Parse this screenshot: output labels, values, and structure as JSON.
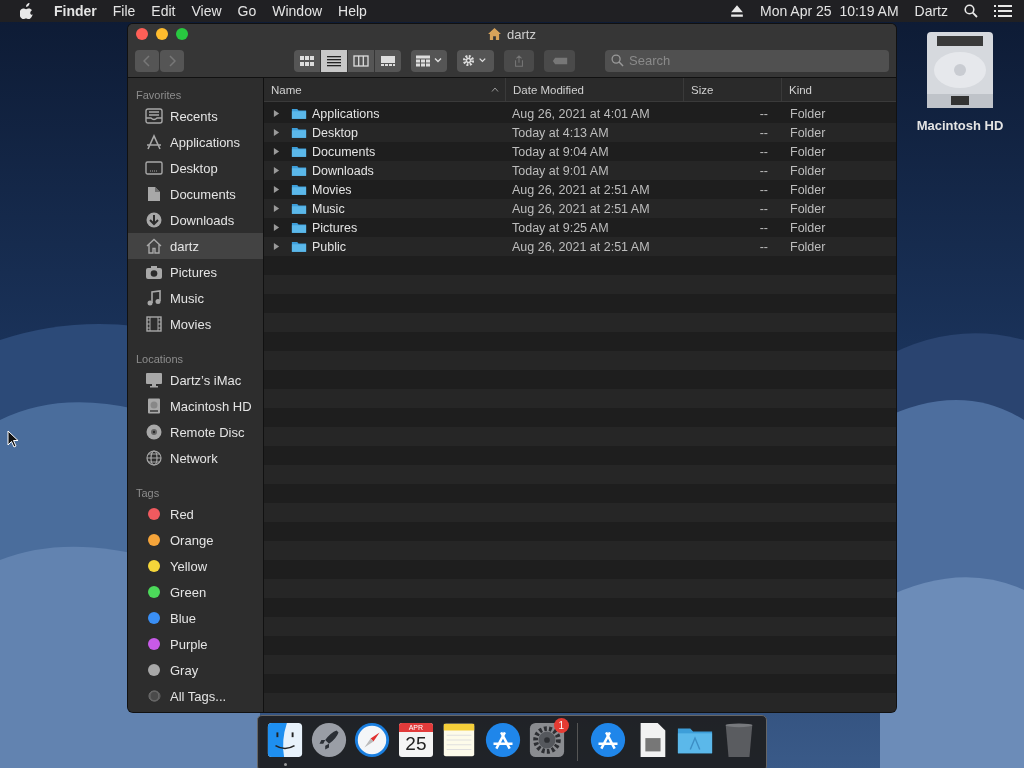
{
  "menu_bar": {
    "app": "Finder",
    "items": [
      "File",
      "Edit",
      "View",
      "Go",
      "Window",
      "Help"
    ],
    "clock": "Mon Apr 25  10:19 AM",
    "user": "Dartz"
  },
  "window": {
    "title": "dartz"
  },
  "toolbar": {
    "views": [
      {
        "kind": "icons",
        "selected": false
      },
      {
        "kind": "list",
        "selected": true
      },
      {
        "kind": "columns",
        "selected": false
      },
      {
        "kind": "gallery",
        "selected": false
      }
    ],
    "search": {
      "placeholder": "Search"
    }
  },
  "sidebar": {
    "sections": [
      {
        "title": "Favorites",
        "items": [
          {
            "label": "Recents",
            "kind": "recents",
            "selected": false
          },
          {
            "label": "Applications",
            "kind": "applications",
            "selected": false
          },
          {
            "label": "Desktop",
            "kind": "desktop",
            "selected": false
          },
          {
            "label": "Documents",
            "kind": "documents",
            "selected": false
          },
          {
            "label": "Downloads",
            "kind": "downloads",
            "selected": false
          },
          {
            "label": "dartz",
            "kind": "home",
            "selected": true
          },
          {
            "label": "Pictures",
            "kind": "pictures",
            "selected": false
          },
          {
            "label": "Music",
            "kind": "music",
            "selected": false
          },
          {
            "label": "Movies",
            "kind": "movies",
            "selected": false
          }
        ]
      },
      {
        "title": "Locations",
        "items": [
          {
            "label": "Dartz’s iMac",
            "kind": "computer",
            "selected": false
          },
          {
            "label": "Macintosh HD",
            "kind": "disk",
            "selected": false
          },
          {
            "label": "Remote Disc",
            "kind": "disc",
            "selected": false
          },
          {
            "label": "Network",
            "kind": "network",
            "selected": false
          }
        ]
      },
      {
        "title": "Tags",
        "items": [
          {
            "label": "Red",
            "kind": "tag",
            "color": "#f05a5f",
            "selected": false
          },
          {
            "label": "Orange",
            "kind": "tag",
            "color": "#f5a43a",
            "selected": false
          },
          {
            "label": "Yellow",
            "kind": "tag",
            "color": "#f5d63a",
            "selected": false
          },
          {
            "label": "Green",
            "kind": "tag",
            "color": "#4cd95a",
            "selected": false
          },
          {
            "label": "Blue",
            "kind": "tag",
            "color": "#3a8ff5",
            "selected": false
          },
          {
            "label": "Purple",
            "kind": "tag",
            "color": "#c85ae8",
            "selected": false
          },
          {
            "label": "Gray",
            "kind": "tag",
            "color": "#a8a8a8",
            "selected": false
          },
          {
            "label": "All Tags...",
            "kind": "all-tags",
            "selected": false
          }
        ]
      }
    ]
  },
  "table": {
    "columns": [
      {
        "label": "Name",
        "sorted": true
      },
      {
        "label": "Date Modified",
        "sorted": false
      },
      {
        "label": "Size",
        "sorted": false
      },
      {
        "label": "Kind",
        "sorted": false
      }
    ],
    "rows": [
      {
        "name": "Applications",
        "date": "Aug 26, 2021 at 4:01 AM",
        "size": "--",
        "kind": "Folder"
      },
      {
        "name": "Desktop",
        "date": "Today at 4:13 AM",
        "size": "--",
        "kind": "Folder"
      },
      {
        "name": "Documents",
        "date": "Today at 9:04 AM",
        "size": "--",
        "kind": "Folder"
      },
      {
        "name": "Downloads",
        "date": "Today at 9:01 AM",
        "size": "--",
        "kind": "Folder"
      },
      {
        "name": "Movies",
        "date": "Aug 26, 2021 at 2:51 AM",
        "size": "--",
        "kind": "Folder"
      },
      {
        "name": "Music",
        "date": "Aug 26, 2021 at 2:51 AM",
        "size": "--",
        "kind": "Folder"
      },
      {
        "name": "Pictures",
        "date": "Today at 9:25 AM",
        "size": "--",
        "kind": "Folder"
      },
      {
        "name": "Public",
        "date": "Aug 26, 2021 at 2:51 AM",
        "size": "--",
        "kind": "Folder"
      }
    ]
  },
  "desktop_icons": [
    {
      "label": "Macintosh HD"
    }
  ],
  "dock": {
    "items": [
      {
        "kind": "finder",
        "running": true
      },
      {
        "kind": "launchpad"
      },
      {
        "kind": "safari"
      },
      {
        "kind": "calendar",
        "month": "APR",
        "day": "25"
      },
      {
        "kind": "notes"
      },
      {
        "kind": "appstore"
      },
      {
        "kind": "preferences",
        "badge": "1"
      },
      {
        "kind": "separator"
      },
      {
        "kind": "appstore"
      },
      {
        "kind": "document"
      },
      {
        "kind": "folder"
      },
      {
        "kind": "trash"
      }
    ]
  }
}
